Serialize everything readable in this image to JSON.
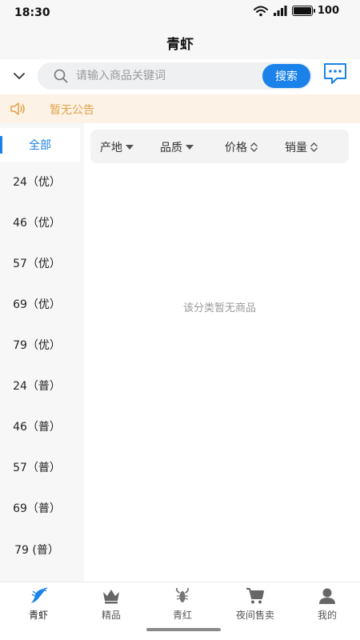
{
  "status_bar": {
    "time": "18:30",
    "battery": "100"
  },
  "header": {
    "title": "青虾"
  },
  "search": {
    "placeholder": "请输入商品关键词",
    "button_label": "搜索"
  },
  "notice": {
    "text": "暂无公告"
  },
  "sidebar": {
    "active_label": "全部",
    "items": [
      "24（优）",
      "46（优）",
      "57（优）",
      "69（优）",
      "79（优）",
      "24（普）",
      "46（普）",
      "57（普）",
      "69（普）",
      "79 (普）"
    ]
  },
  "sort_bar": {
    "origin": "产地",
    "quality": "品质",
    "price": "价格",
    "sales": "销量"
  },
  "empty_message": "该分类暂无商品",
  "tabs": [
    {
      "label": "青虾",
      "icon": "shrimp-icon",
      "active": true
    },
    {
      "label": "精品",
      "icon": "crown-icon",
      "active": false
    },
    {
      "label": "青红",
      "icon": "lobster-icon",
      "active": false
    },
    {
      "label": "夜间售卖",
      "icon": "cart-icon",
      "active": false
    },
    {
      "label": "我的",
      "icon": "profile-icon",
      "active": false
    }
  ],
  "colors": {
    "accent": "#1a82e8",
    "notice_bg": "#fdf2e6",
    "notice_text": "#e2a24a"
  }
}
